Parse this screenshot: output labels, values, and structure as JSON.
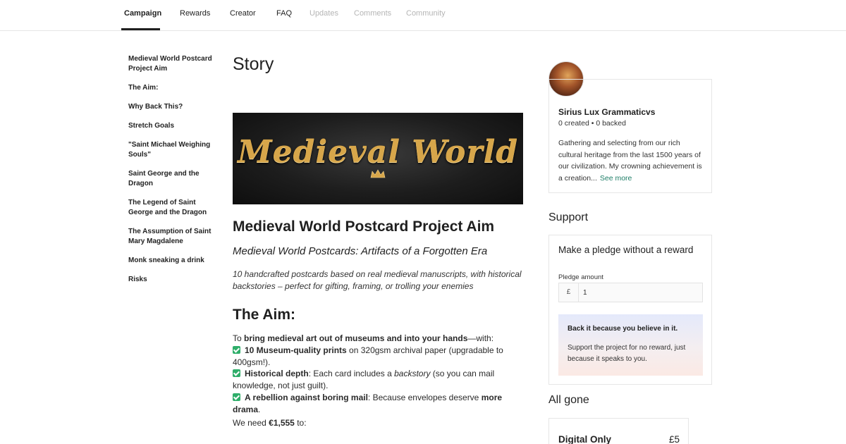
{
  "nav": {
    "tabs": [
      {
        "label": "Campaign"
      },
      {
        "label": "Rewards"
      },
      {
        "label": "Creator"
      },
      {
        "label": "FAQ"
      },
      {
        "label": "Updates"
      },
      {
        "label": "Comments"
      },
      {
        "label": "Community"
      }
    ]
  },
  "sidebar": {
    "items": [
      {
        "label": "Medieval World Postcard Project Aim"
      },
      {
        "label": "The Aim:"
      },
      {
        "label": "Why Back This?"
      },
      {
        "label": "Stretch Goals"
      },
      {
        "label": "\"Saint Michael Weighing Souls\""
      },
      {
        "label": "Saint George and the Dragon"
      },
      {
        "label": "The Legend of Saint George and the Dragon"
      },
      {
        "label": "The Assumption of Saint Mary Magdalene"
      },
      {
        "label": "Monk sneaking a drink"
      },
      {
        "label": "Risks"
      }
    ]
  },
  "story": {
    "title": "Story",
    "banner_text": "Medieval World",
    "heading": "Medieval World Postcard Project Aim",
    "subheading": "Medieval World Postcards: Artifacts of a Forgotten Era",
    "description": "10 handcrafted postcards based on real medieval manuscripts, with historical backstories – perfect for gifting, framing, or trolling your enemies",
    "aim_heading": "The Aim:",
    "aim": {
      "intro_pre": "To ",
      "intro_bold": "bring medieval art out of museums and into your hands",
      "intro_post": "—with:",
      "item1_bold": "10 Museum-quality prints",
      "item1_text": " on 320gsm archival paper (upgradable to 400gsm!).",
      "item2_bold": "Historical depth",
      "item2_text_a": ": Each card includes a ",
      "item2_italic": "backstory",
      "item2_text_b": " (so you can mail knowledge, not just guilt).",
      "item3_bold": "A rebellion against boring mail",
      "item3_text": ": Because envelopes deserve ",
      "item3_bold2": "more drama",
      "item3_end": "."
    },
    "need_pre": "We need ",
    "need_amount": "€1,555",
    "need_post": " to:"
  },
  "creator": {
    "name": "Sirius Lux Grammaticvs",
    "created": "0 created",
    "separator": "•",
    "backed": "0 backed",
    "bio": "Gathering and selecting from our rich cultural heritage from the last 1500 years of our civilization. My crowning achievement is a creation...",
    "see_more": "See more"
  },
  "support": {
    "heading": "Support",
    "pledge_title": "Make a pledge without a reward",
    "pledge_label": "Pledge amount",
    "currency": "£",
    "amount_value": "1",
    "back_title": "Back it because you believe in it.",
    "back_desc": "Support the project for no reward, just because it speaks to you."
  },
  "all_gone": {
    "heading": "All gone",
    "reward_name": "Digital Only",
    "reward_price": "£5"
  },
  "colors": {
    "accent_link": "#1e7e67",
    "check_green": "#2fae6a",
    "banner_gold": "#d7a64a"
  }
}
